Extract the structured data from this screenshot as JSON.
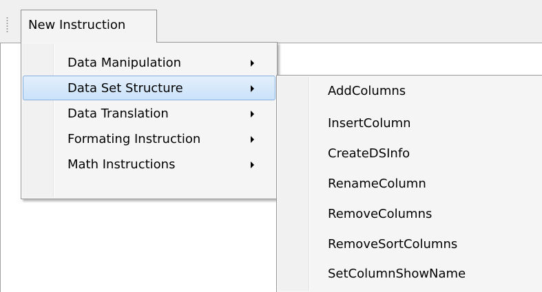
{
  "menubar": {
    "items": [
      {
        "label": "New Instruction"
      }
    ]
  },
  "main_menu": {
    "items": [
      {
        "label": "Data Manipulation",
        "has_submenu": true
      },
      {
        "label": "Data Set Structure",
        "has_submenu": true,
        "highlighted": true
      },
      {
        "label": "Data Translation",
        "has_submenu": true
      },
      {
        "label": "Formating Instruction",
        "has_submenu": true
      },
      {
        "label": "Math Instructions",
        "has_submenu": true
      }
    ]
  },
  "submenu": {
    "parent": "Data Set Structure",
    "items": [
      {
        "label": "AddColumns"
      },
      {
        "label": "InsertColumn"
      },
      {
        "label": "CreateDSInfo"
      },
      {
        "label": "RenameColumn"
      },
      {
        "label": "RemoveColumns"
      },
      {
        "label": "RemoveSortColumns"
      },
      {
        "label": "SetColumnShowName"
      }
    ]
  },
  "colors": {
    "highlight_fill": "#cbe2f9",
    "highlight_border": "#84acdd",
    "menu_background": "#f5f5f5",
    "menubar_background": "#f0f0f0"
  }
}
